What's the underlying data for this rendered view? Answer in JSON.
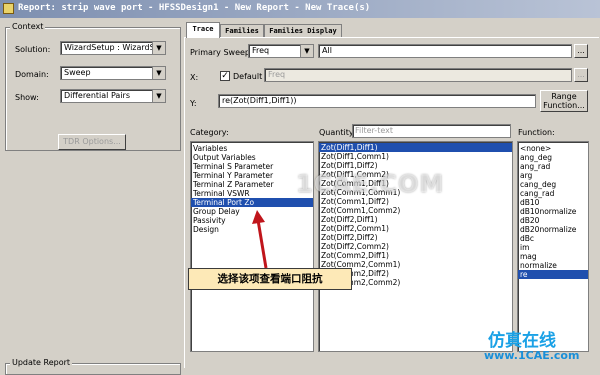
{
  "window": {
    "title": "Report: strip wave port - HFSSDesign1 - New Report - New Trace(s)"
  },
  "context": {
    "group_title": "Context",
    "solution_label": "Solution:",
    "solution_value": "WizardSetup : WizardSwe",
    "domain_label": "Domain:",
    "domain_value": "Sweep",
    "show_label": "Show:",
    "show_value": "Differential Pairs",
    "tdr_button": "TDR Options..."
  },
  "update_report": {
    "group_title": "Update Report"
  },
  "tabs": [
    "Trace",
    "Families",
    "Families Display"
  ],
  "trace": {
    "primary_sweep_label": "Primary Sweep:",
    "primary_sweep_value": "Freq",
    "primary_sweep_field": "All",
    "ellipsis": "...",
    "x_label": "X:",
    "default_label": "Default",
    "default_checked": true,
    "x_value": "Freq",
    "y_label": "Y:",
    "y_value": "re(Zot(Diff1,Diff1))",
    "range_function_button": "Range Function..."
  },
  "category": {
    "label": "Category:",
    "items": [
      "Variables",
      "Output Variables",
      "Terminal S Parameter",
      "Terminal Y Parameter",
      "Terminal Z Parameter",
      "Terminal VSWR",
      "Terminal Port Zo",
      "Group Delay",
      "Passivity",
      "Design"
    ],
    "selected_index": 6
  },
  "quantity": {
    "label": "Quantity:",
    "filter_placeholder": "Filter-text",
    "items": [
      "Zot(Diff1,Diff1)",
      "Zot(Diff1,Comm1)",
      "Zot(Diff1,Diff2)",
      "Zot(Diff1,Comm2)",
      "Zot(Comm1,Diff1)",
      "Zot(Comm1,Comm1)",
      "Zot(Comm1,Diff2)",
      "Zot(Comm1,Comm2)",
      "Zot(Diff2,Diff1)",
      "Zot(Diff2,Comm1)",
      "Zot(Diff2,Diff2)",
      "Zot(Diff2,Comm2)",
      "Zot(Comm2,Diff1)",
      "Zot(Comm2,Comm1)",
      "Zot(Comm2,Diff2)",
      "Zot(Comm2,Comm2)"
    ],
    "selected_index": 0
  },
  "function": {
    "label": "Function:",
    "items": [
      "<none>",
      "ang_deg",
      "ang_rad",
      "arg",
      "cang_deg",
      "cang_rad",
      "dB10",
      "dB10normalize",
      "dB20",
      "dB20normalize",
      "dBc",
      "im",
      "mag",
      "normalize",
      "re"
    ],
    "selected_index": 14
  },
  "annotation": {
    "text": "选择该项查看端口阻抗"
  },
  "watermark": {
    "center": "1CAE.COM",
    "brand_cn": "仿真在线",
    "brand_url": "www.1CAE.com"
  },
  "colors": {
    "selection": "#1f4fae",
    "annotation_bg": "#fde9b7",
    "arrow": "#c0151b"
  }
}
